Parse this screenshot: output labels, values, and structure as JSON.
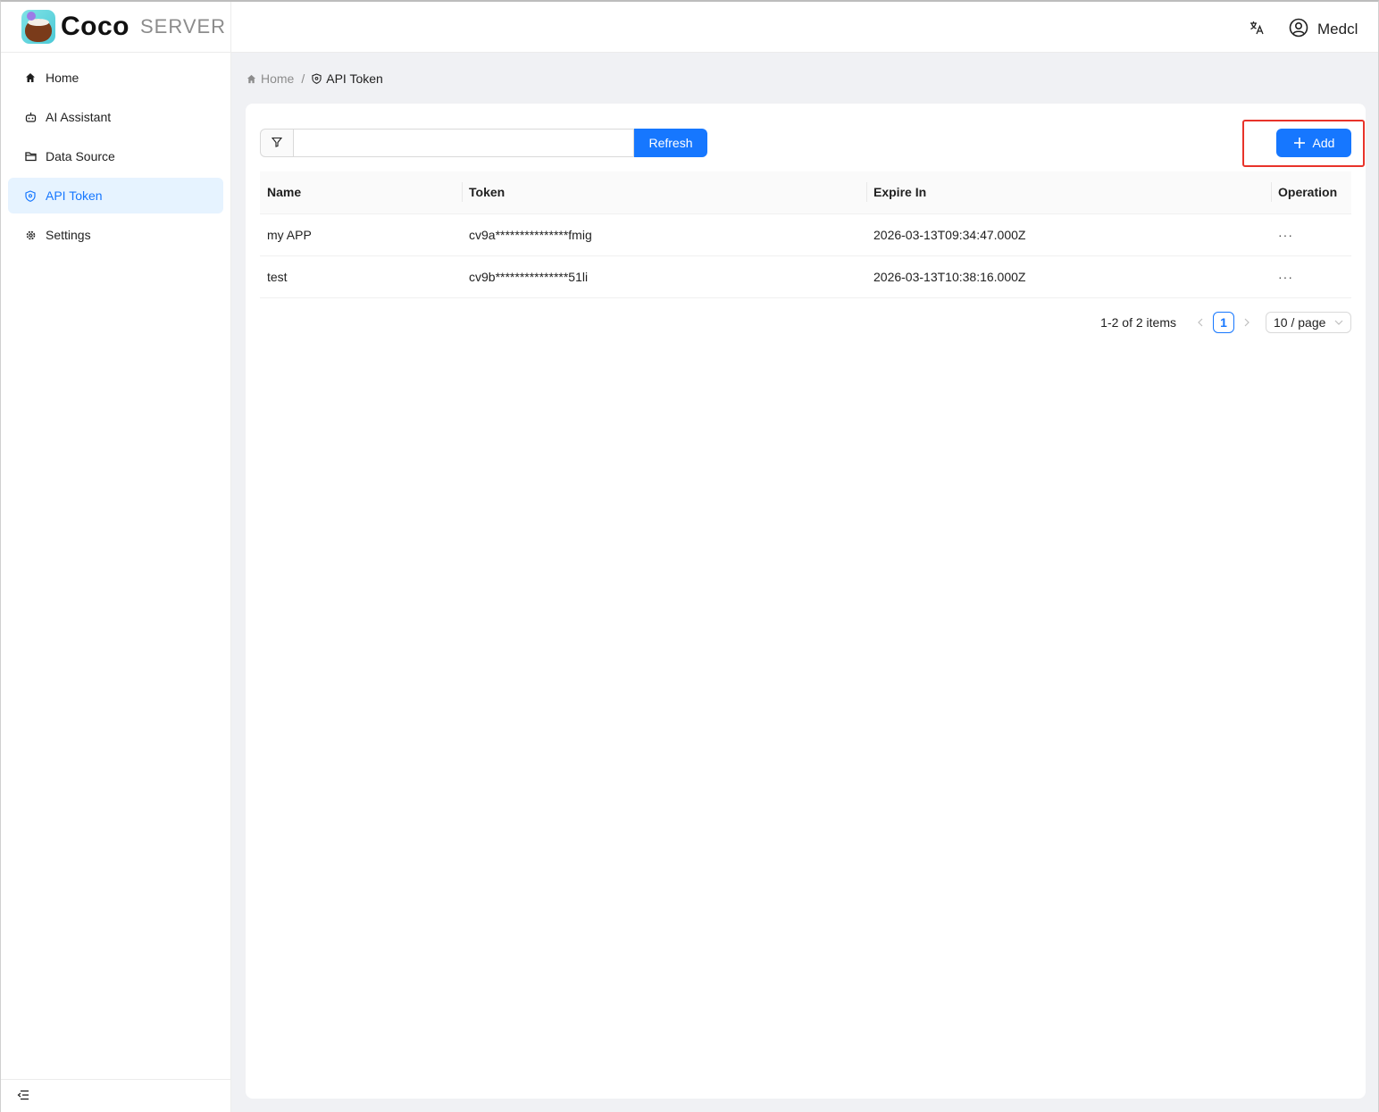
{
  "brand": {
    "name": "Coco",
    "sub": "SERVER"
  },
  "sidebar": {
    "items": [
      {
        "label": "Home",
        "icon": "home-icon",
        "active": false
      },
      {
        "label": "AI Assistant",
        "icon": "robot-icon",
        "active": false
      },
      {
        "label": "Data Source",
        "icon": "folder-icon",
        "active": false
      },
      {
        "label": "API Token",
        "icon": "shield-icon",
        "active": true
      },
      {
        "label": "Settings",
        "icon": "gear-icon",
        "active": false
      }
    ]
  },
  "header": {
    "user": "Medcl"
  },
  "breadcrumb": {
    "home": "Home",
    "separator": "/",
    "current": "API Token"
  },
  "toolbar": {
    "filter_value": "",
    "filter_placeholder": "",
    "refresh_label": "Refresh",
    "add_label": "Add"
  },
  "table": {
    "columns": [
      "Name",
      "Token",
      "Expire In",
      "Operation"
    ],
    "rows": [
      {
        "name": "my APP",
        "token": "cv9a***************fmig",
        "expire": "2026-03-13T09:34:47.000Z",
        "operation": "···"
      },
      {
        "name": "test",
        "token": "cv9b***************51li",
        "expire": "2026-03-13T10:38:16.000Z",
        "operation": "···"
      }
    ]
  },
  "pagination": {
    "total_text": "1-2 of 2 items",
    "current_page": "1",
    "page_size": "10 / page"
  },
  "colors": {
    "primary": "#1677ff",
    "highlight": "#e8332a",
    "active_bg": "#e6f3ff"
  }
}
